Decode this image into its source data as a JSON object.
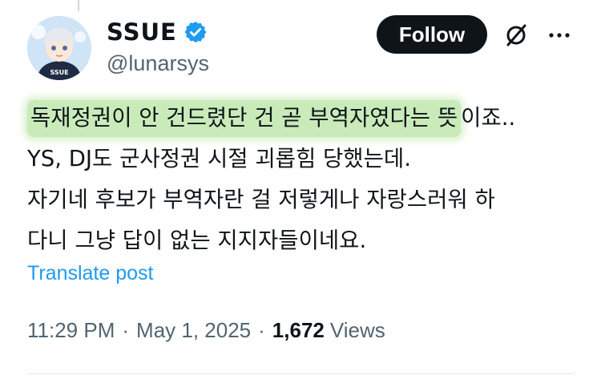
{
  "author": {
    "display_name": "SSUE",
    "handle": "@lunarsys",
    "verified": true,
    "avatar_text": "SSUE"
  },
  "header": {
    "follow_label": "Follow",
    "grok_icon": "grok-icon",
    "more_icon": "more-icon"
  },
  "tweet": {
    "highlighted": "독재정권이 안 건드렸단 건 곧 부역자였다는 뜻",
    "line1_rest": "이죠..",
    "line2": "YS, DJ도 군사정권 시절 괴롭힘 당했는데.",
    "line3": "자기네 후보가 부역자란 걸 저렇게나 자랑스러워 하",
    "line4": "다니 그냥 답이 없는 지지자들이네요."
  },
  "translate_label": "Translate post",
  "meta": {
    "time": "11:29 PM",
    "dot1": "·",
    "date": "May 1, 2025",
    "dot2": "·",
    "views_count": "1,672",
    "views_label": "Views"
  },
  "colors": {
    "accent": "#1d9bf0",
    "highlight": "#c9ebb9",
    "text": "#0f1419",
    "muted": "#536471"
  }
}
